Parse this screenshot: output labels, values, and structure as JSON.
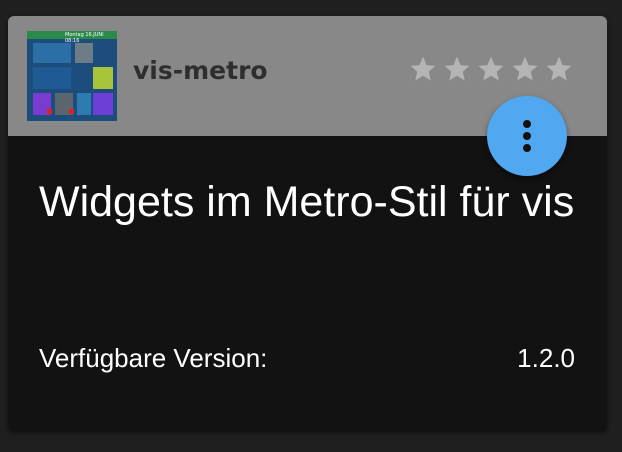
{
  "card": {
    "title": "vis-metro",
    "description": "Widgets im Metro-Stil für vis",
    "rating": {
      "value": 0,
      "max": 5,
      "star_color": "#b4b4b4"
    },
    "version_label": "Verfügbare Version:",
    "version_value": "1.2.0",
    "menu_icon": "more-vert-icon",
    "thumbnail_text": "Montag 16.JUNI 08:16",
    "colors": {
      "header_bg": "#888888",
      "body_bg": "#121212",
      "fab_bg": "#4fa8f0",
      "page_bg": "#1f1f1f"
    }
  }
}
